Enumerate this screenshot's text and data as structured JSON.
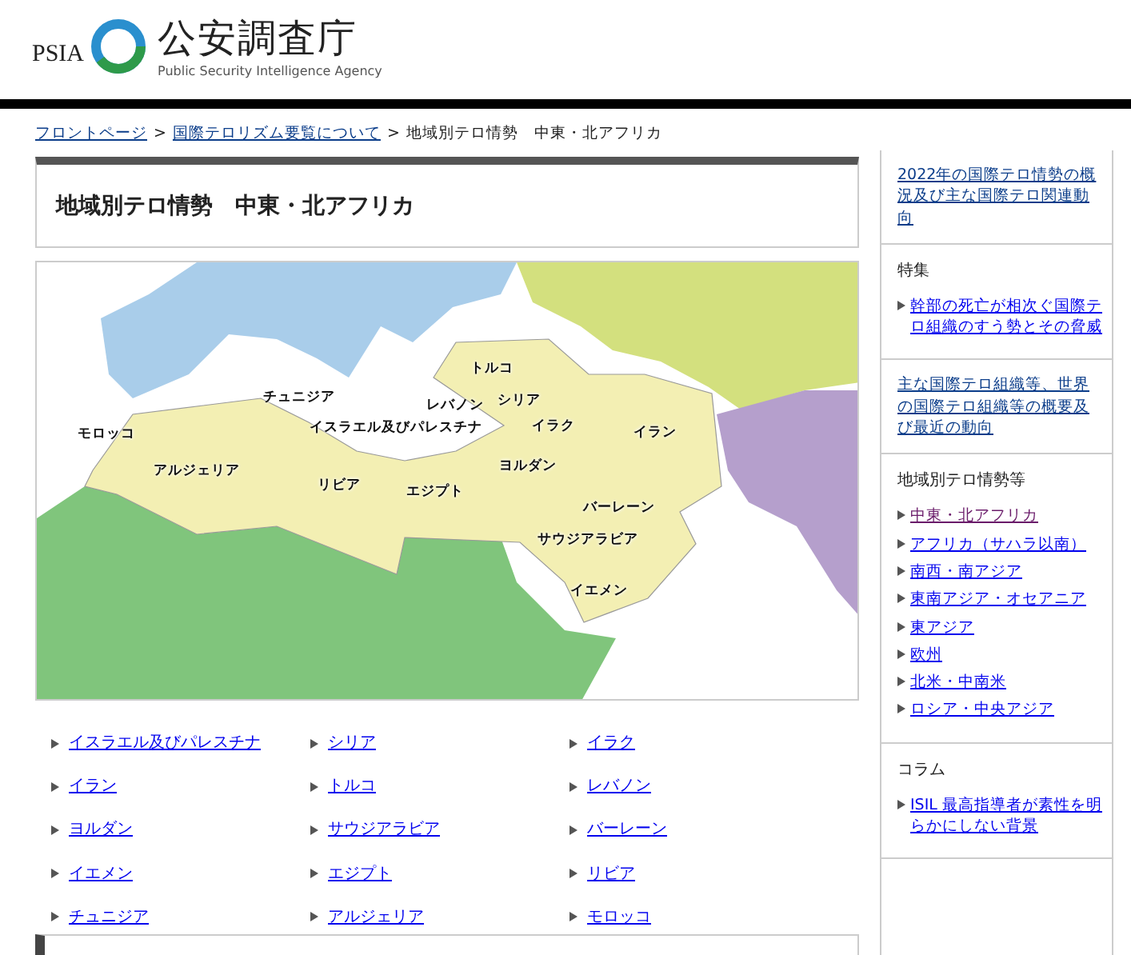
{
  "header": {
    "logo_mark": "PSIA",
    "title": "公安調査庁",
    "subtitle": "Public Security Intelligence Agency"
  },
  "breadcrumb": {
    "separator": ">",
    "items": [
      {
        "text": "フロントページ",
        "link": true
      },
      {
        "text": "国際テロリズム要覧について",
        "link": true
      },
      {
        "text": "地域別テロ情勢　中東・北アフリカ",
        "link": false
      }
    ]
  },
  "page_title": "地域別テロ情勢　中東・北アフリカ",
  "map_labels": [
    "トルコ",
    "チュニジア",
    "レバノン",
    "シリア",
    "イスラエル及びパレスチナ",
    "モロッコ",
    "イラク",
    "イラン",
    "アルジェリア",
    "リビア",
    "エジプト",
    "ヨルダン",
    "バーレーン",
    "サウジアラビア",
    "イエメン"
  ],
  "country_links": [
    "イスラエル及びパレスチナ",
    "シリア",
    "イラク",
    "イラン",
    "トルコ",
    "レバノン",
    "ヨルダン",
    "サウジアラビア",
    "バーレーン",
    "イエメン",
    "エジプト",
    "リビア",
    "チュニジア",
    "アルジェリア",
    "モロッコ"
  ],
  "sidebar": [
    {
      "kind": "link",
      "text": "2022年の国際テロ情勢の概況及び主な国際テロ関連動向"
    },
    {
      "kind": "list",
      "heading": "特集",
      "items": [
        {
          "text": "幹部の死亡が相次ぐ国際テロ組織のすう勢とその脅威",
          "visited": false
        }
      ]
    },
    {
      "kind": "link",
      "text": "主な国際テロ組織等、世界の国際テロ組織等の概要及び最近の動向"
    },
    {
      "kind": "list",
      "heading": "地域別テロ情勢等",
      "items": [
        {
          "text": "中東・北アフリカ",
          "visited": true
        },
        {
          "text": "アフリカ（サハラ以南）",
          "visited": false
        },
        {
          "text": "南西・南アジア",
          "visited": false
        },
        {
          "text": "東南アジア・オセアニア",
          "visited": false
        },
        {
          "text": "東アジア",
          "visited": false
        },
        {
          "text": "欧州",
          "visited": false
        },
        {
          "text": "北米・中南米",
          "visited": false
        },
        {
          "text": "ロシア・中央アジア",
          "visited": false
        }
      ]
    },
    {
      "kind": "list",
      "heading": "コラム",
      "items": [
        {
          "text": "ISIL 最高指導者が素性を明らかにしない背景",
          "visited": false
        }
      ]
    }
  ]
}
